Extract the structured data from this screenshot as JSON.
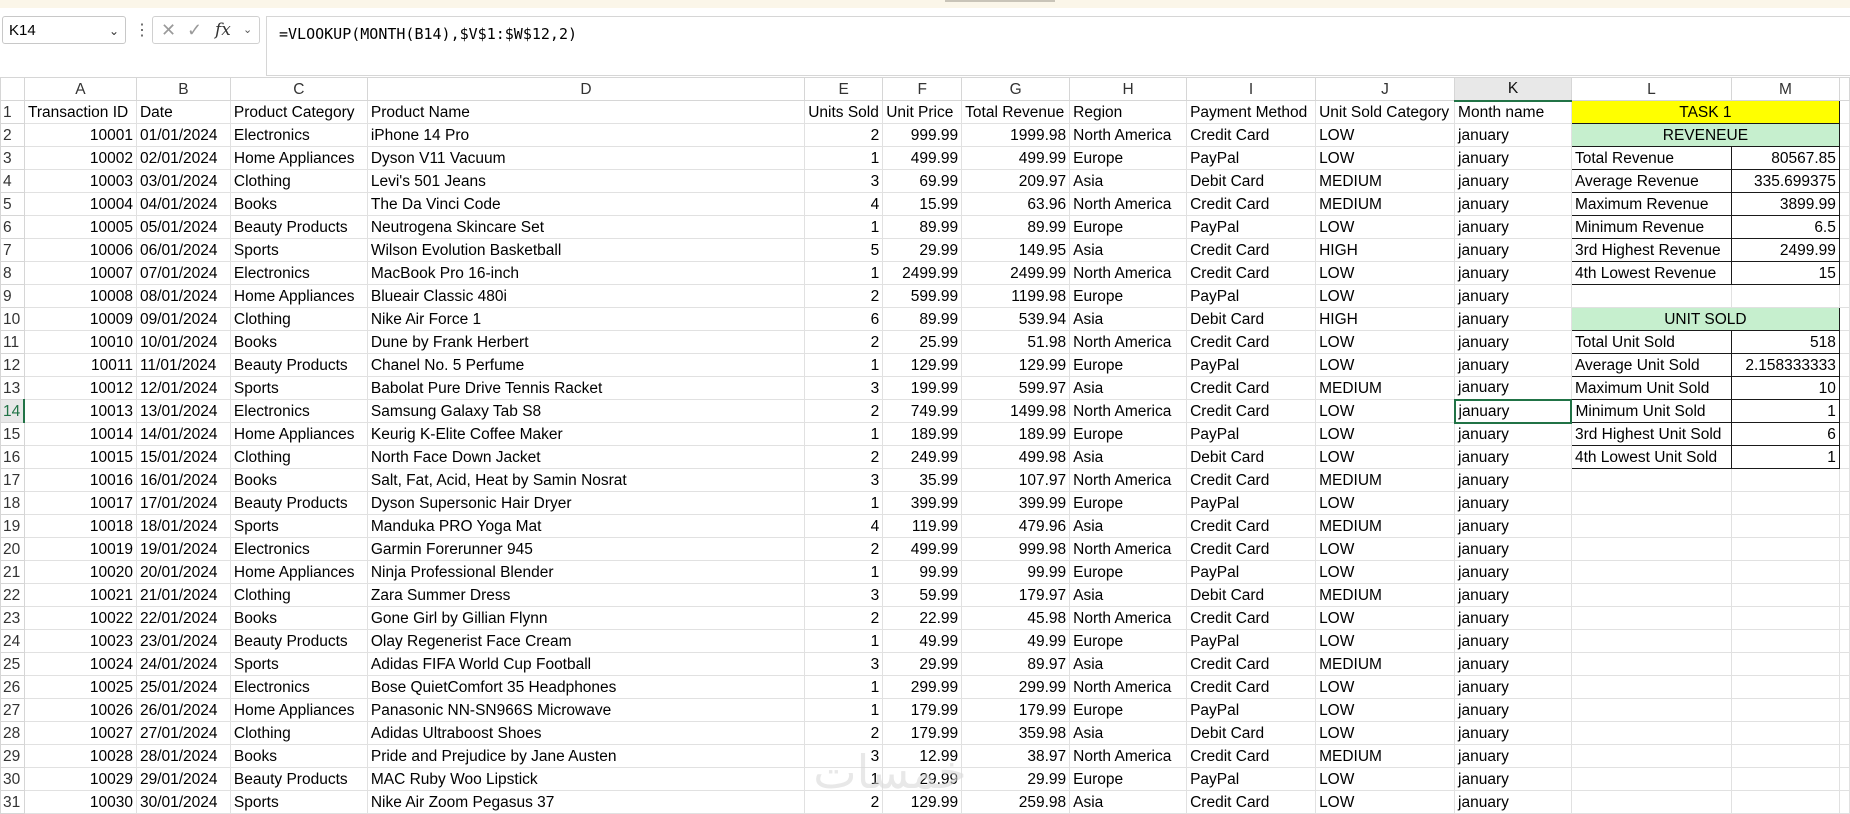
{
  "name_box": {
    "value": "K14"
  },
  "formula_bar": {
    "formula": "=VLOOKUP(MONTH(B14),$V$1:$W$12,2)",
    "icons": [
      "cancel-icon",
      "confirm-icon",
      "function-icon"
    ]
  },
  "columns": [
    "A",
    "B",
    "C",
    "D",
    "E",
    "F",
    "G",
    "H",
    "I",
    "J",
    "K",
    "L",
    "M"
  ],
  "selected": {
    "column": "K",
    "row": 14
  },
  "headers": [
    "Transaction ID",
    "Date",
    "Product Category",
    "Product Name",
    "Units Sold",
    "Unit Price",
    "Total Revenue",
    "Region",
    "Payment Method",
    "Unit Sold Category",
    "Month name"
  ],
  "rows": [
    [
      "10001",
      "01/01/2024",
      "Electronics",
      "iPhone 14 Pro",
      "2",
      "999.99",
      "1999.98",
      "North America",
      "Credit Card",
      "LOW",
      "january"
    ],
    [
      "10002",
      "02/01/2024",
      "Home Appliances",
      "Dyson V11 Vacuum",
      "1",
      "499.99",
      "499.99",
      "Europe",
      "PayPal",
      "LOW",
      "january"
    ],
    [
      "10003",
      "03/01/2024",
      "Clothing",
      "Levi's 501 Jeans",
      "3",
      "69.99",
      "209.97",
      "Asia",
      "Debit Card",
      "MEDIUM",
      "january"
    ],
    [
      "10004",
      "04/01/2024",
      "Books",
      "The Da Vinci Code",
      "4",
      "15.99",
      "63.96",
      "North America",
      "Credit Card",
      "MEDIUM",
      "january"
    ],
    [
      "10005",
      "05/01/2024",
      "Beauty Products",
      "Neutrogena Skincare Set",
      "1",
      "89.99",
      "89.99",
      "Europe",
      "PayPal",
      "LOW",
      "january"
    ],
    [
      "10006",
      "06/01/2024",
      "Sports",
      "Wilson Evolution Basketball",
      "5",
      "29.99",
      "149.95",
      "Asia",
      "Credit Card",
      "HIGH",
      "january"
    ],
    [
      "10007",
      "07/01/2024",
      "Electronics",
      "MacBook Pro 16-inch",
      "1",
      "2499.99",
      "2499.99",
      "North America",
      "Credit Card",
      "LOW",
      "january"
    ],
    [
      "10008",
      "08/01/2024",
      "Home Appliances",
      "Blueair Classic 480i",
      "2",
      "599.99",
      "1199.98",
      "Europe",
      "PayPal",
      "LOW",
      "january"
    ],
    [
      "10009",
      "09/01/2024",
      "Clothing",
      "Nike Air Force 1",
      "6",
      "89.99",
      "539.94",
      "Asia",
      "Debit Card",
      "HIGH",
      "january"
    ],
    [
      "10010",
      "10/01/2024",
      "Books",
      "Dune by Frank Herbert",
      "2",
      "25.99",
      "51.98",
      "North America",
      "Credit Card",
      "LOW",
      "january"
    ],
    [
      "10011",
      "11/01/2024",
      "Beauty Products",
      "Chanel No. 5 Perfume",
      "1",
      "129.99",
      "129.99",
      "Europe",
      "PayPal",
      "LOW",
      "january"
    ],
    [
      "10012",
      "12/01/2024",
      "Sports",
      "Babolat Pure Drive Tennis Racket",
      "3",
      "199.99",
      "599.97",
      "Asia",
      "Credit Card",
      "MEDIUM",
      "january"
    ],
    [
      "10013",
      "13/01/2024",
      "Electronics",
      "Samsung Galaxy Tab S8",
      "2",
      "749.99",
      "1499.98",
      "North America",
      "Credit Card",
      "LOW",
      "january"
    ],
    [
      "10014",
      "14/01/2024",
      "Home Appliances",
      "Keurig K-Elite Coffee Maker",
      "1",
      "189.99",
      "189.99",
      "Europe",
      "PayPal",
      "LOW",
      "january"
    ],
    [
      "10015",
      "15/01/2024",
      "Clothing",
      "North Face Down Jacket",
      "2",
      "249.99",
      "499.98",
      "Asia",
      "Debit Card",
      "LOW",
      "january"
    ],
    [
      "10016",
      "16/01/2024",
      "Books",
      "Salt, Fat, Acid, Heat by Samin Nosrat",
      "3",
      "35.99",
      "107.97",
      "North America",
      "Credit Card",
      "MEDIUM",
      "january"
    ],
    [
      "10017",
      "17/01/2024",
      "Beauty Products",
      "Dyson Supersonic Hair Dryer",
      "1",
      "399.99",
      "399.99",
      "Europe",
      "PayPal",
      "LOW",
      "january"
    ],
    [
      "10018",
      "18/01/2024",
      "Sports",
      "Manduka PRO Yoga Mat",
      "4",
      "119.99",
      "479.96",
      "Asia",
      "Credit Card",
      "MEDIUM",
      "january"
    ],
    [
      "10019",
      "19/01/2024",
      "Electronics",
      "Garmin Forerunner 945",
      "2",
      "499.99",
      "999.98",
      "North America",
      "Credit Card",
      "LOW",
      "january"
    ],
    [
      "10020",
      "20/01/2024",
      "Home Appliances",
      "Ninja Professional Blender",
      "1",
      "99.99",
      "99.99",
      "Europe",
      "PayPal",
      "LOW",
      "january"
    ],
    [
      "10021",
      "21/01/2024",
      "Clothing",
      "Zara Summer Dress",
      "3",
      "59.99",
      "179.97",
      "Asia",
      "Debit Card",
      "MEDIUM",
      "january"
    ],
    [
      "10022",
      "22/01/2024",
      "Books",
      "Gone Girl by Gillian Flynn",
      "2",
      "22.99",
      "45.98",
      "North America",
      "Credit Card",
      "LOW",
      "january"
    ],
    [
      "10023",
      "23/01/2024",
      "Beauty Products",
      "Olay Regenerist Face Cream",
      "1",
      "49.99",
      "49.99",
      "Europe",
      "PayPal",
      "LOW",
      "january"
    ],
    [
      "10024",
      "24/01/2024",
      "Sports",
      "Adidas FIFA World Cup Football",
      "3",
      "29.99",
      "89.97",
      "Asia",
      "Credit Card",
      "MEDIUM",
      "january"
    ],
    [
      "10025",
      "25/01/2024",
      "Electronics",
      "Bose QuietComfort 35 Headphones",
      "1",
      "299.99",
      "299.99",
      "North America",
      "Credit Card",
      "LOW",
      "january"
    ],
    [
      "10026",
      "26/01/2024",
      "Home Appliances",
      "Panasonic NN-SN966S Microwave",
      "1",
      "179.99",
      "179.99",
      "Europe",
      "PayPal",
      "LOW",
      "january"
    ],
    [
      "10027",
      "27/01/2024",
      "Clothing",
      "Adidas Ultraboost Shoes",
      "2",
      "179.99",
      "359.98",
      "Asia",
      "Debit Card",
      "LOW",
      "january"
    ],
    [
      "10028",
      "28/01/2024",
      "Books",
      "Pride and Prejudice by Jane Austen",
      "3",
      "12.99",
      "38.97",
      "North America",
      "Credit Card",
      "MEDIUM",
      "january"
    ],
    [
      "10029",
      "29/01/2024",
      "Beauty Products",
      "MAC Ruby Woo Lipstick",
      "1",
      "29.99",
      "29.99",
      "Europe",
      "PayPal",
      "LOW",
      "january"
    ],
    [
      "10030",
      "30/01/2024",
      "Sports",
      "Nike Air Zoom Pegasus 37",
      "2",
      "129.99",
      "259.98",
      "Asia",
      "Credit Card",
      "LOW",
      "january"
    ]
  ],
  "task": {
    "title": "TASK 1",
    "revenue_header": "REVENEUE",
    "revenue": [
      {
        "label": "Total Revenue",
        "value": "80567.85"
      },
      {
        "label": "Average Revenue",
        "value": "335.699375"
      },
      {
        "label": "Maximum Revenue",
        "value": "3899.99"
      },
      {
        "label": "Minimum Revenue",
        "value": "6.5"
      },
      {
        "label": "3rd Highest Revenue",
        "value": "2499.99"
      },
      {
        "label": "4th Lowest Revenue",
        "value": "15"
      }
    ],
    "units_header": "UNIT SOLD",
    "units": [
      {
        "label": "Total Unit Sold",
        "value": "518"
      },
      {
        "label": "Average Unit Sold",
        "value": "2.158333333"
      },
      {
        "label": "Maximum Unit Sold",
        "value": "10"
      },
      {
        "label": "Minimum Unit Sold",
        "value": "1"
      },
      {
        "label": "3rd Highest Unit Sold",
        "value": "6"
      },
      {
        "label": "4th Lowest Unit Sold",
        "value": "1"
      }
    ]
  },
  "watermark": "خمسات",
  "colors": {
    "selection": "#217346",
    "task_title_bg": "#ffff00",
    "section_header_bg": "#c6efce"
  }
}
